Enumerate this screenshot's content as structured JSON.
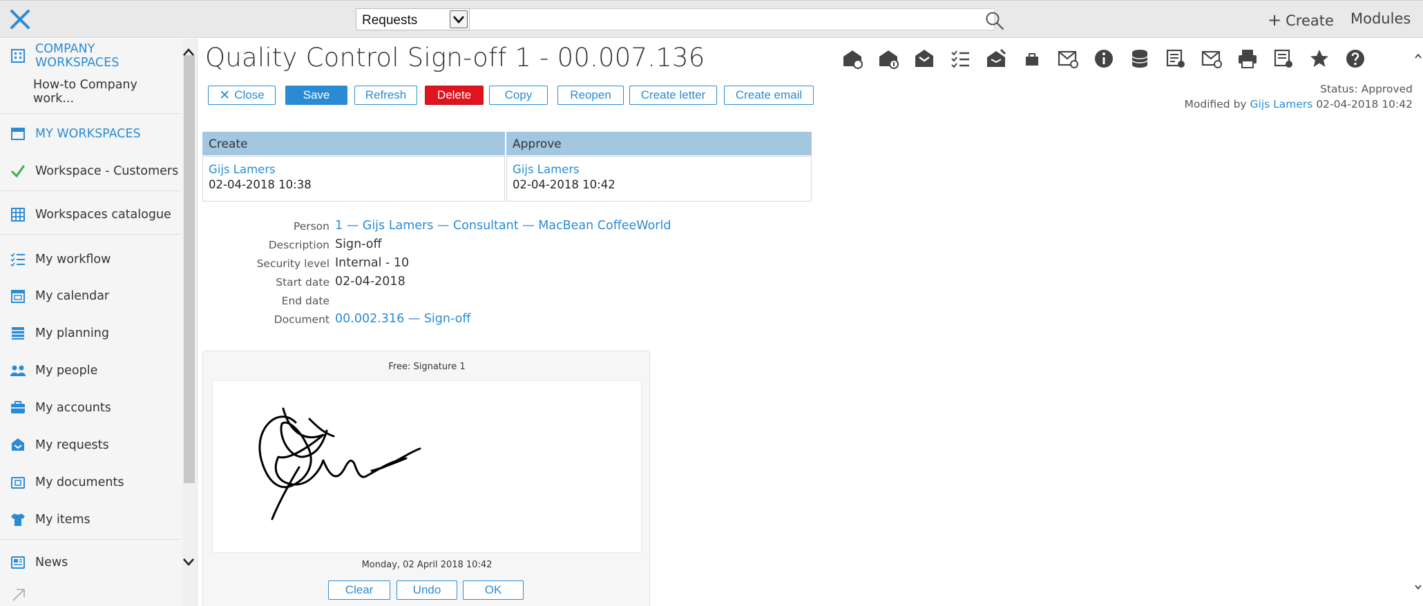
{
  "topbar": {
    "module_select": "Requests",
    "search_value": "",
    "create_label": "Create",
    "modules_label": "Modules"
  },
  "sidebar": {
    "items": [
      {
        "label": "COMPANY WORKSPACES",
        "icon": "building-icon"
      },
      {
        "label": "How-to Company work..."
      },
      {
        "label": "MY WORKSPACES",
        "icon": "window-icon"
      },
      {
        "label": "Workspace - Customers",
        "icon": "checkmark-icon"
      },
      {
        "label": "Workspaces catalogue",
        "icon": "grid-icon"
      },
      {
        "label": "My workflow",
        "icon": "checklist-icon"
      },
      {
        "label": "My calendar",
        "icon": "calendar-icon"
      },
      {
        "label": "My planning",
        "icon": "planning-icon"
      },
      {
        "label": "My people",
        "icon": "people-icon"
      },
      {
        "label": "My accounts",
        "icon": "briefcase-icon"
      },
      {
        "label": "My requests",
        "icon": "request-icon"
      },
      {
        "label": "My documents",
        "icon": "document-icon"
      },
      {
        "label": "My items",
        "icon": "shirt-icon"
      },
      {
        "label": "News",
        "icon": "news-icon"
      }
    ]
  },
  "main": {
    "title": "Quality Control Sign-off 1 - 00.007.136",
    "actions": {
      "close": "Close",
      "save": "Save",
      "refresh": "Refresh",
      "delete": "Delete",
      "copy": "Copy",
      "reopen": "Reopen",
      "create_letter": "Create letter",
      "create_email": "Create email"
    },
    "status": {
      "status_line": "Status: Approved",
      "modified_prefix": "Modified by",
      "modified_by": "Gijs Lamers",
      "modified_at": "02-04-2018 10:42"
    },
    "approval": {
      "headers": [
        "Create",
        "Approve"
      ],
      "cells": [
        {
          "name": "Gijs Lamers",
          "date": "02-04-2018 10:38"
        },
        {
          "name": "Gijs Lamers",
          "date": "02-04-2018 10:42"
        }
      ]
    },
    "details": {
      "person_label": "Person",
      "person_value": "1 — Gijs Lamers — Consultant — MacBean CoffeeWorld",
      "description_label": "Description",
      "description_value": "Sign-off",
      "security_label": "Security level",
      "security_value": "Internal - 10",
      "start_label": "Start date",
      "start_value": "02-04-2018",
      "end_label": "End date",
      "end_value": "",
      "document_label": "Document",
      "document_value": "00.002.316 — Sign-off"
    },
    "signature": {
      "title": "Free: Signature 1",
      "date": "Monday, 02 April 2018 10:42",
      "clear": "Clear",
      "undo": "Undo",
      "ok": "OK"
    }
  },
  "colors": {
    "accent": "#2a8bd4",
    "delete": "#e0141e",
    "table_header": "#a3c6e1"
  }
}
